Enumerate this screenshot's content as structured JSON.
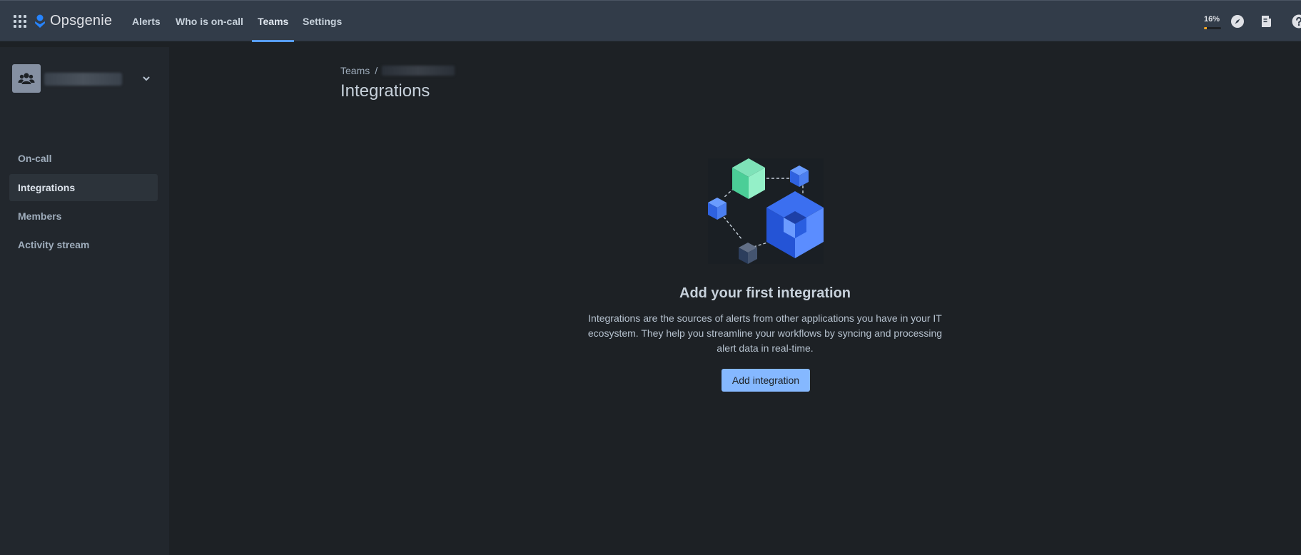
{
  "app": {
    "name": "Opsgenie"
  },
  "topnav": {
    "items": [
      {
        "label": "Alerts",
        "active": false
      },
      {
        "label": "Who is on-call",
        "active": false
      },
      {
        "label": "Teams",
        "active": true
      },
      {
        "label": "Settings",
        "active": false
      }
    ],
    "usage_label": "16%",
    "usage_fraction": 0.16,
    "icons": [
      "app-switcher-icon",
      "opsgenie-logo-icon",
      "compass-icon",
      "notes-icon",
      "help-icon"
    ]
  },
  "sidebar": {
    "team_icon": "team-icon",
    "items": [
      {
        "label": "On-call",
        "active": false
      },
      {
        "label": "Integrations",
        "active": true
      },
      {
        "label": "Members",
        "active": false
      },
      {
        "label": "Activity stream",
        "active": false
      }
    ]
  },
  "main": {
    "breadcrumb_root": "Teams",
    "breadcrumb_separator": "/",
    "title": "Integrations",
    "empty_state": {
      "title": "Add your first integration",
      "description": "Integrations are the sources of alerts from other applications you have in your IT ecosystem. They help you streamline your workflows by syncing and processing alert data in real-time.",
      "button_label": "Add integration"
    }
  },
  "colors": {
    "topnav_bg": "#323c49",
    "sidebar_bg": "#22272d",
    "page_bg": "#1d2125",
    "accent": "#579dff",
    "button_bg": "#85b8ff"
  }
}
